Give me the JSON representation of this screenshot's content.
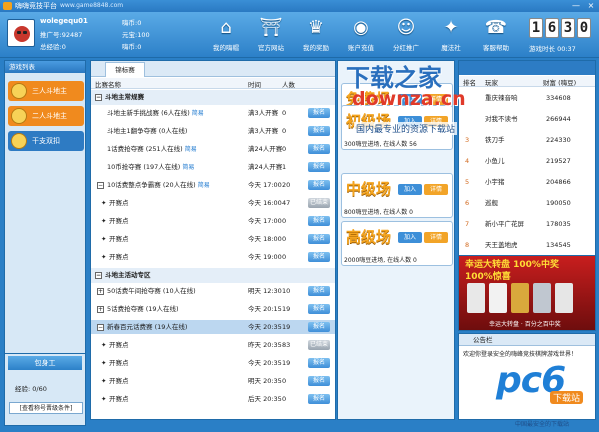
{
  "window": {
    "title": "嗨嗨竞技平台",
    "url": "www.game8848.com",
    "minimize": "—",
    "close": "×"
  },
  "user": {
    "name": "wolegequ01",
    "referrer": "推广号:92487",
    "level": "总经验:0",
    "huanbi": "嗨币:0",
    "yuanbao": "元宝:100",
    "lebi": "嗨币:0"
  },
  "nav": [
    {
      "label": "我的嗨帽",
      "icon": "house-icon",
      "glyph": "⌂"
    },
    {
      "label": "官方网站",
      "icon": "temple-icon",
      "glyph": "⛩"
    },
    {
      "label": "我的奖励",
      "icon": "trophy-icon",
      "glyph": "♛"
    },
    {
      "label": "账户充值",
      "icon": "coins-icon",
      "glyph": "◉"
    },
    {
      "label": "分红推广",
      "icon": "people-icon",
      "glyph": "☺"
    },
    {
      "label": "魔法社",
      "icon": "wand-icon",
      "glyph": "✦"
    },
    {
      "label": "客服帮助",
      "icon": "support-icon",
      "glyph": "☎"
    }
  ],
  "clock": {
    "digits": [
      "1",
      "6",
      "3",
      "0"
    ],
    "game_time": "游戏时长 00:37"
  },
  "sidebar": {
    "header": "游戏列表",
    "items": [
      {
        "label": "三人斗地主",
        "color": "#f08a1e"
      },
      {
        "label": "二人斗地主",
        "color": "#f08a1e"
      },
      {
        "label": "干支双扣",
        "color": "#2e7bc3"
      }
    ]
  },
  "profile": {
    "title": "包身工",
    "exp": "经验: 0/60",
    "link": "[查看称号晋级条件]"
  },
  "main": {
    "tab": "锦标赛",
    "columns": {
      "name": "比赛名称",
      "time": "时间",
      "count": "人数"
    },
    "rows": [
      {
        "type": "section",
        "name": "斗地主常规赛",
        "box": "−"
      },
      {
        "type": "item",
        "name": "斗地主新手挑战赛 (6人在线)",
        "tag": "简易",
        "time": "满3人开赛",
        "count": "0",
        "btn": "报名"
      },
      {
        "type": "item",
        "name": "斗地主1翻争夺赛 (0人在线)",
        "tag": "",
        "time": "满3人开赛",
        "count": "0",
        "btn": "报名"
      },
      {
        "type": "item",
        "name": "1话费抢夺赛 (251人在线)",
        "tag": "简易",
        "time": "满24人开赛",
        "count": "0",
        "btn": "报名"
      },
      {
        "type": "item",
        "name": "10币抢夺赛 (197人在线)",
        "tag": "简易",
        "time": "满24人开赛",
        "count": "1",
        "btn": "报名"
      },
      {
        "type": "sub",
        "name": "10话费整点争霸赛 (20人在线)",
        "tag": "简易",
        "time": "今天 17:00",
        "count": "20",
        "btn": "报名",
        "box": "−"
      },
      {
        "type": "child",
        "name": "开赛点",
        "time": "今天 16:00",
        "count": "47",
        "btn": "已结束",
        "ended": true
      },
      {
        "type": "child",
        "name": "开赛点",
        "time": "今天 17:00",
        "count": "0",
        "btn": "报名"
      },
      {
        "type": "child",
        "name": "开赛点",
        "time": "今天 18:00",
        "count": "0",
        "btn": "报名"
      },
      {
        "type": "child",
        "name": "开赛点",
        "time": "今天 19:00",
        "count": "0",
        "btn": "报名"
      },
      {
        "type": "section",
        "name": "斗地主活动专区",
        "box": "−"
      },
      {
        "type": "sub",
        "name": "50话费午间抢夺赛 (10人在线)",
        "tag": "",
        "time": "明天 12:30",
        "count": "10",
        "btn": "报名",
        "box": "+"
      },
      {
        "type": "sub",
        "name": "5话费抢夺赛 (19人在线)",
        "tag": "",
        "time": "今天 20:15",
        "count": "19",
        "btn": "报名",
        "box": "+"
      },
      {
        "type": "sub",
        "name": "新春百元话费赛 (19人在线)",
        "tag": "",
        "time": "今天 20:35",
        "count": "19",
        "btn": "报名",
        "box": "−",
        "selected": true
      },
      {
        "type": "child",
        "name": "开赛点",
        "time": "昨天 20:35",
        "count": "83",
        "btn": "已结束",
        "ended": true
      },
      {
        "type": "child",
        "name": "开赛点",
        "time": "今天 20:35",
        "count": "19",
        "btn": "报名"
      },
      {
        "type": "child",
        "name": "开赛点",
        "time": "明天 20:35",
        "count": "0",
        "btn": "报名"
      },
      {
        "type": "child",
        "name": "开赛点",
        "time": "后天 20:35",
        "count": "0",
        "btn": "报名"
      }
    ]
  },
  "rooms": [
    {
      "name": "免费场",
      "join": "加入",
      "detail": "详情",
      "info": ""
    },
    {
      "name": "初级场",
      "join": "加入",
      "detail": "详情",
      "info": "300嗨豆进场, 在线人数 56"
    },
    {
      "name": "中级场",
      "join": "加入",
      "detail": "详情",
      "info": "800嗨豆进场, 在线人数 0"
    },
    {
      "name": "高级场",
      "join": "加入",
      "detail": "详情",
      "info": "2000嗨豆进场, 在线人数 0"
    }
  ],
  "rank": {
    "columns": {
      "no": "排名",
      "name": "玩家",
      "money": "财富 (嗨豆)"
    },
    "rows": [
      {
        "no": "",
        "name": "重庆辣音响",
        "money": "334608"
      },
      {
        "no": "",
        "name": "对我不读书",
        "money": "266944"
      },
      {
        "no": "3",
        "name": "铁刀手",
        "money": "224330"
      },
      {
        "no": "4",
        "name": "小鱼儿",
        "money": "219527"
      },
      {
        "no": "5",
        "name": "小宇猪",
        "money": "204866"
      },
      {
        "no": "6",
        "name": "巡舰",
        "money": "190050"
      },
      {
        "no": "7",
        "name": "新小平广花屏",
        "money": "178035"
      },
      {
        "no": "8",
        "name": "天王盖地虎",
        "money": "134545"
      }
    ]
  },
  "ad": {
    "line1": "幸运大转盘 100%中奖",
    "line2": "100%惊喜",
    "footer": "幸运大转盘 · 百分之百中奖"
  },
  "notice": {
    "header": "公告栏",
    "text": "欢迎你登录安全的嗨峰竞技棋牌游戏世界！"
  },
  "watermarks": {
    "a": "下载之家",
    "b": "downza.cn",
    "c": "国内最专业的资源下载站",
    "d": "pc6",
    "e": "下载站",
    "f": "中国最安全的下载站"
  }
}
